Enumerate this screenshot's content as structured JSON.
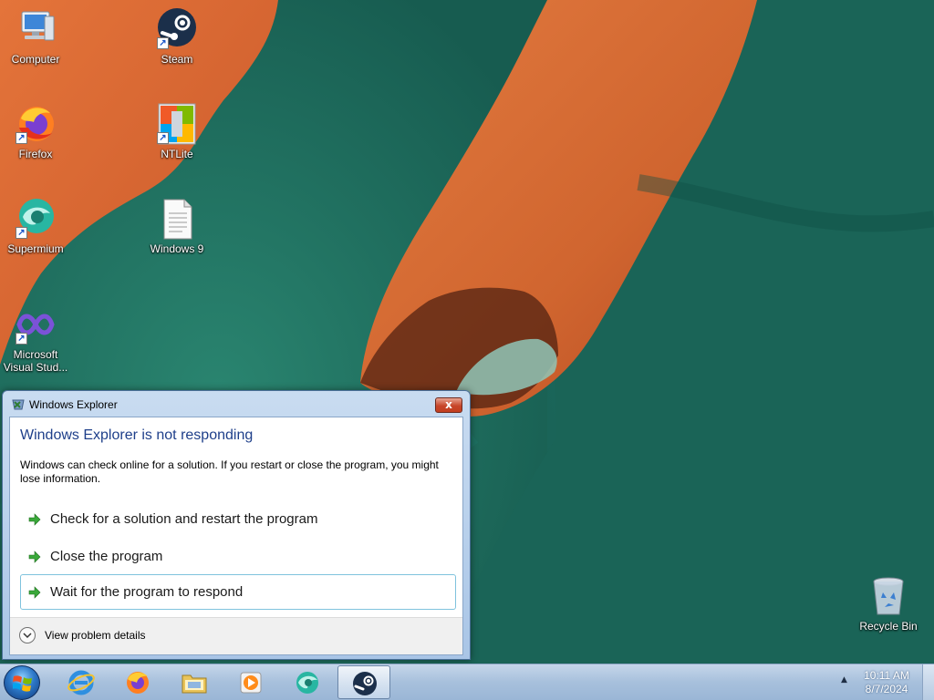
{
  "desktop": {
    "icons": [
      {
        "label": "Computer",
        "icon": "computer-icon",
        "shortcut": false
      },
      {
        "label": "Steam",
        "icon": "steam-icon",
        "shortcut": true
      },
      {
        "label": "Firefox",
        "icon": "firefox-icon",
        "shortcut": true
      },
      {
        "label": "NTLite",
        "icon": "ntlite-icon",
        "shortcut": true
      },
      {
        "label": "Supermium",
        "icon": "supermium-icon",
        "shortcut": true
      },
      {
        "label": "Windows 9",
        "icon": "document-icon",
        "shortcut": false
      },
      {
        "label": "Microsoft Visual Stud...",
        "icon": "visual-studio-icon",
        "shortcut": true
      },
      {
        "label": "Recycle Bin",
        "icon": "recycle-bin-icon",
        "shortcut": false
      }
    ]
  },
  "dialog": {
    "title": "Windows Explorer",
    "close_label": "x",
    "heading": "Windows Explorer is not responding",
    "message": "Windows can check online for a solution. If you restart or close the program, you might lose information.",
    "options": [
      {
        "label": "Check for a solution and restart the program",
        "focused": false
      },
      {
        "label": "Close the program",
        "focused": false
      },
      {
        "label": "Wait for the program to respond",
        "focused": true
      }
    ],
    "details_label": "View problem details"
  },
  "taskbar": {
    "start": "windows-start-icon",
    "items": [
      {
        "icon": "internet-explorer-icon",
        "active": false
      },
      {
        "icon": "firefox-icon",
        "active": false
      },
      {
        "icon": "file-explorer-icon",
        "active": false
      },
      {
        "icon": "media-player-icon",
        "active": false
      },
      {
        "icon": "supermium-icon",
        "active": false
      },
      {
        "icon": "steam-icon",
        "active": true
      }
    ],
    "tray_arrow": "▲",
    "clock": {
      "time": "10:11 AM",
      "date": "8/7/2024"
    }
  },
  "colors": {
    "sand": "#d9682f",
    "water": "#1d6f61",
    "dialog_heading": "#1e3f8a",
    "arrow_green": "#3aa83a"
  }
}
